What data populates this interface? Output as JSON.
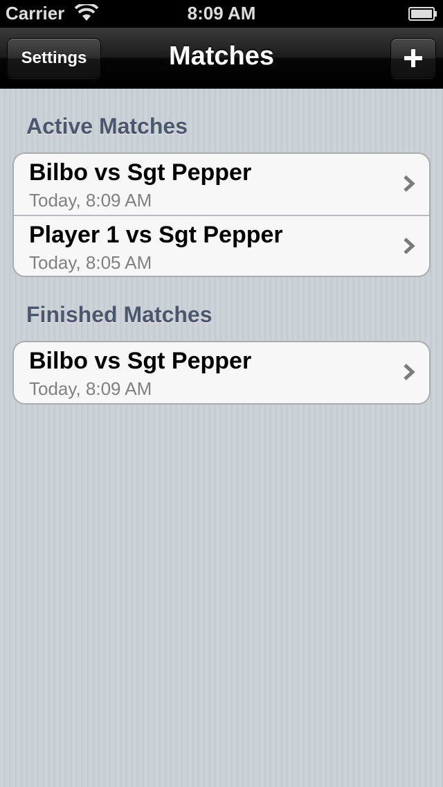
{
  "status_bar": {
    "carrier": "Carrier",
    "time": "8:09 AM",
    "icons": [
      "wifi-icon",
      "battery-icon"
    ]
  },
  "nav": {
    "title": "Matches",
    "left_button": "Settings",
    "right_button_icon": "plus-icon"
  },
  "sections": {
    "active": {
      "header": "Active Matches",
      "rows": [
        {
          "title": "Bilbo vs Sgt Pepper",
          "subtitle": "Today, 8:09 AM"
        },
        {
          "title": "Player 1 vs Sgt Pepper",
          "subtitle": "Today, 8:05 AM"
        }
      ]
    },
    "finished": {
      "header": "Finished Matches",
      "rows": [
        {
          "title": "Bilbo vs Sgt Pepper",
          "subtitle": "Today, 8:09 AM"
        }
      ]
    }
  },
  "colors": {
    "section_header": "#4c566c",
    "cell_background": "#f7f7f7",
    "subtitle": "#808080"
  }
}
